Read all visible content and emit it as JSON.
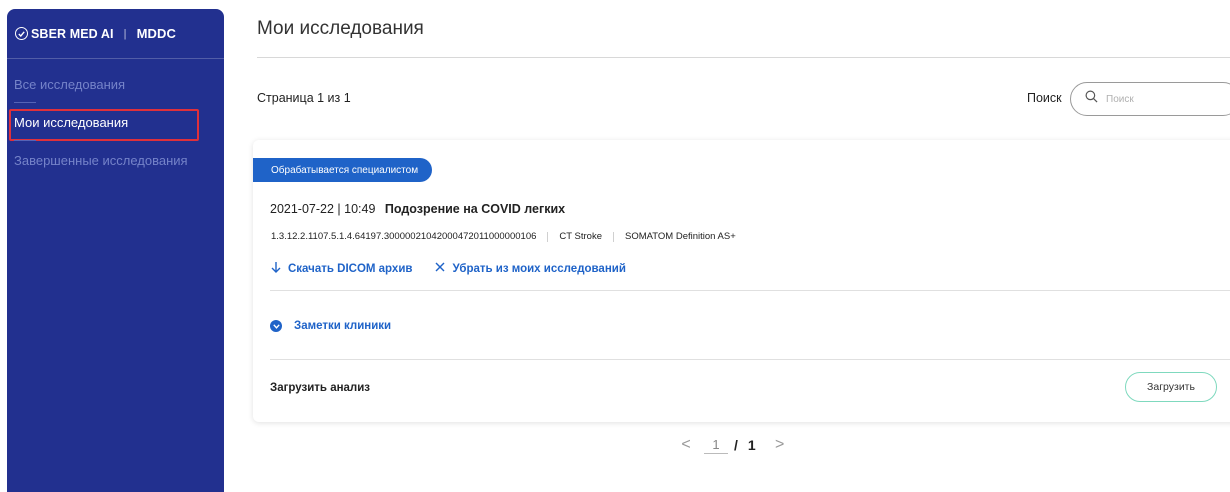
{
  "sidebar": {
    "brand": "SBER MED AI",
    "brand_separator": "|",
    "product": "MDDC",
    "items": [
      {
        "label": "Все исследования",
        "active": false
      },
      {
        "label": "Мои исследования",
        "active": true
      },
      {
        "label": "Завершенные исследования",
        "active": false
      }
    ]
  },
  "main": {
    "title": "Мои исследования",
    "page_info": "Страница 1 из 1",
    "search": {
      "label": "Поиск",
      "placeholder": "Поиск",
      "value": ""
    }
  },
  "study": {
    "status": "Обрабатывается специалистом",
    "datetime": "2021-07-22 | 10:49",
    "diagnosis": "Подозрение на COVID легких",
    "uid": "1.3.12.2.1107.5.1.4.64197.30000021042000472011000000106",
    "modality": "CT Stroke",
    "device": "SOMATOM Definition AS+",
    "actions": {
      "download": "Скачать DICOM архив",
      "remove": "Убрать из моих исследований"
    },
    "notes_label": "Заметки клиники",
    "upload_label": "Загрузить анализ",
    "upload_button": "Загрузить"
  },
  "pagination": {
    "current": "1",
    "separator": "/",
    "total": "1",
    "prev": "<",
    "next": ">"
  },
  "colors": {
    "sidebar": "#22308f",
    "accent": "#1f63c8",
    "upload_border": "#7fd9be",
    "highlight": "#e0303b"
  }
}
